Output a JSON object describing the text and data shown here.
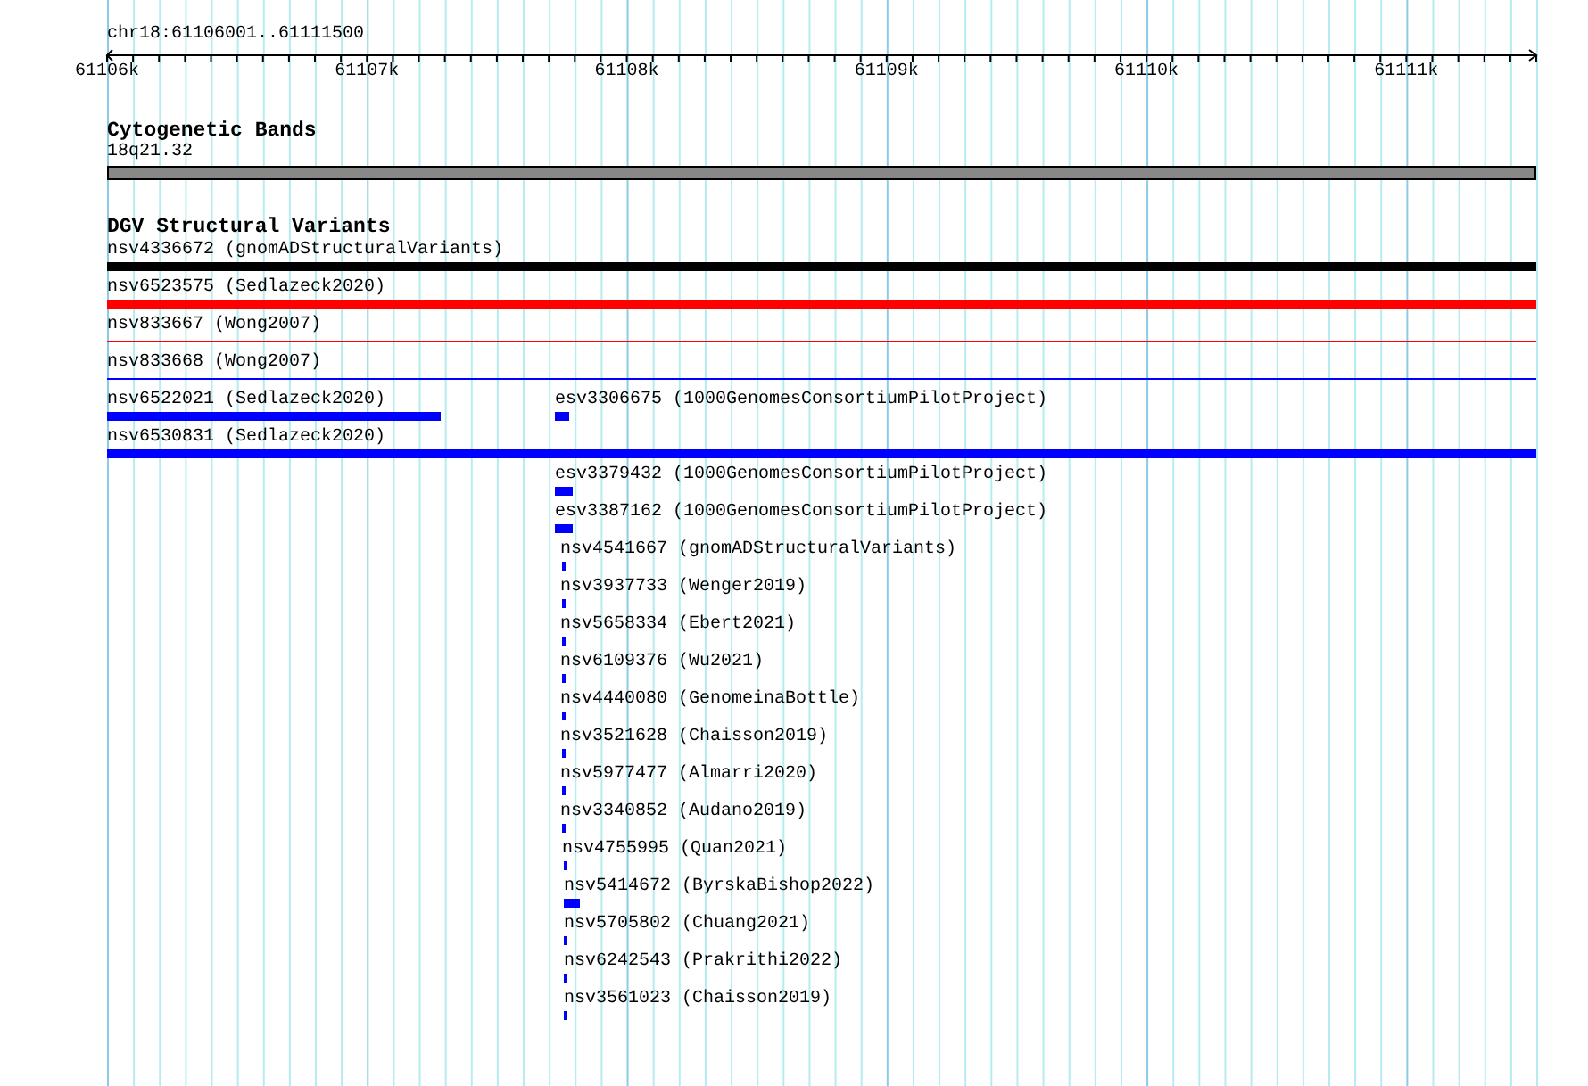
{
  "location": "chr18:61106001..61111500",
  "ruler": {
    "tick_labels": [
      "61106k",
      "61107k",
      "61108k",
      "61109k",
      "61110k",
      "61111k"
    ]
  },
  "cytogenetic_bands": {
    "title": "Cytogenetic Bands",
    "band": {
      "label": "18q21.32",
      "color": "#888888"
    }
  },
  "structural_variants": {
    "title": "DGV Structural Variants",
    "rows": [
      {
        "features": [
          {
            "label": "nsv4336672 (gnomADStructuralVariants)",
            "color": "#000000",
            "kind": "bar"
          }
        ]
      },
      {
        "features": [
          {
            "label": "nsv6523575 (Sedlazeck2020)",
            "color": "#ff0000",
            "kind": "bar"
          }
        ]
      },
      {
        "features": [
          {
            "label": "nsv833667 (Wong2007)",
            "color": "#ff0000",
            "kind": "line"
          }
        ]
      },
      {
        "features": [
          {
            "label": "nsv833668 (Wong2007)",
            "color": "#0000ff",
            "kind": "line"
          }
        ]
      },
      {
        "features": [
          {
            "label": "nsv6522021 (Sedlazeck2020)",
            "color": "#0000ff",
            "kind": "bar"
          },
          {
            "label": "esv3306675 (1000GenomesConsortiumPilotProject)",
            "color": "#0000ff",
            "kind": "bar"
          }
        ]
      },
      {
        "features": [
          {
            "label": "nsv6530831 (Sedlazeck2020)",
            "color": "#0000ff",
            "kind": "bar"
          }
        ]
      },
      {
        "features": [
          {
            "label": "esv3379432 (1000GenomesConsortiumPilotProject)",
            "color": "#0000ff",
            "kind": "bar"
          }
        ]
      },
      {
        "features": [
          {
            "label": "esv3387162 (1000GenomesConsortiumPilotProject)",
            "color": "#0000ff",
            "kind": "bar"
          }
        ]
      },
      {
        "features": [
          {
            "label": "nsv4541667 (gnomADStructuralVariants)",
            "color": "#0000ff",
            "kind": "bar"
          }
        ]
      },
      {
        "features": [
          {
            "label": "nsv3937733 (Wenger2019)",
            "color": "#0000ff",
            "kind": "bar"
          }
        ]
      },
      {
        "features": [
          {
            "label": "nsv5658334 (Ebert2021)",
            "color": "#0000ff",
            "kind": "bar"
          }
        ]
      },
      {
        "features": [
          {
            "label": "nsv6109376 (Wu2021)",
            "color": "#0000ff",
            "kind": "bar"
          }
        ]
      },
      {
        "features": [
          {
            "label": "nsv4440080 (GenomeinaBottle)",
            "color": "#0000ff",
            "kind": "bar"
          }
        ]
      },
      {
        "features": [
          {
            "label": "nsv3521628 (Chaisson2019)",
            "color": "#0000ff",
            "kind": "bar"
          }
        ]
      },
      {
        "features": [
          {
            "label": "nsv5977477 (Almarri2020)",
            "color": "#0000ff",
            "kind": "bar"
          }
        ]
      },
      {
        "features": [
          {
            "label": "nsv3340852 (Audano2019)",
            "color": "#0000ff",
            "kind": "bar"
          }
        ]
      },
      {
        "features": [
          {
            "label": "nsv4755995 (Quan2021)",
            "color": "#0000ff",
            "kind": "bar"
          }
        ]
      },
      {
        "features": [
          {
            "label": "nsv5414672 (ByrskaBishop2022)",
            "color": "#0000ff",
            "kind": "bar"
          }
        ]
      },
      {
        "features": [
          {
            "label": "nsv5705802 (Chuang2021)",
            "color": "#0000ff",
            "kind": "bar"
          }
        ]
      },
      {
        "features": [
          {
            "label": "nsv6242543 (Prakrithi2022)",
            "color": "#0000ff",
            "kind": "bar"
          }
        ]
      },
      {
        "features": [
          {
            "label": "nsv3561023 (Chaisson2019)",
            "color": "#0000ff",
            "kind": "bar"
          }
        ]
      }
    ]
  }
}
